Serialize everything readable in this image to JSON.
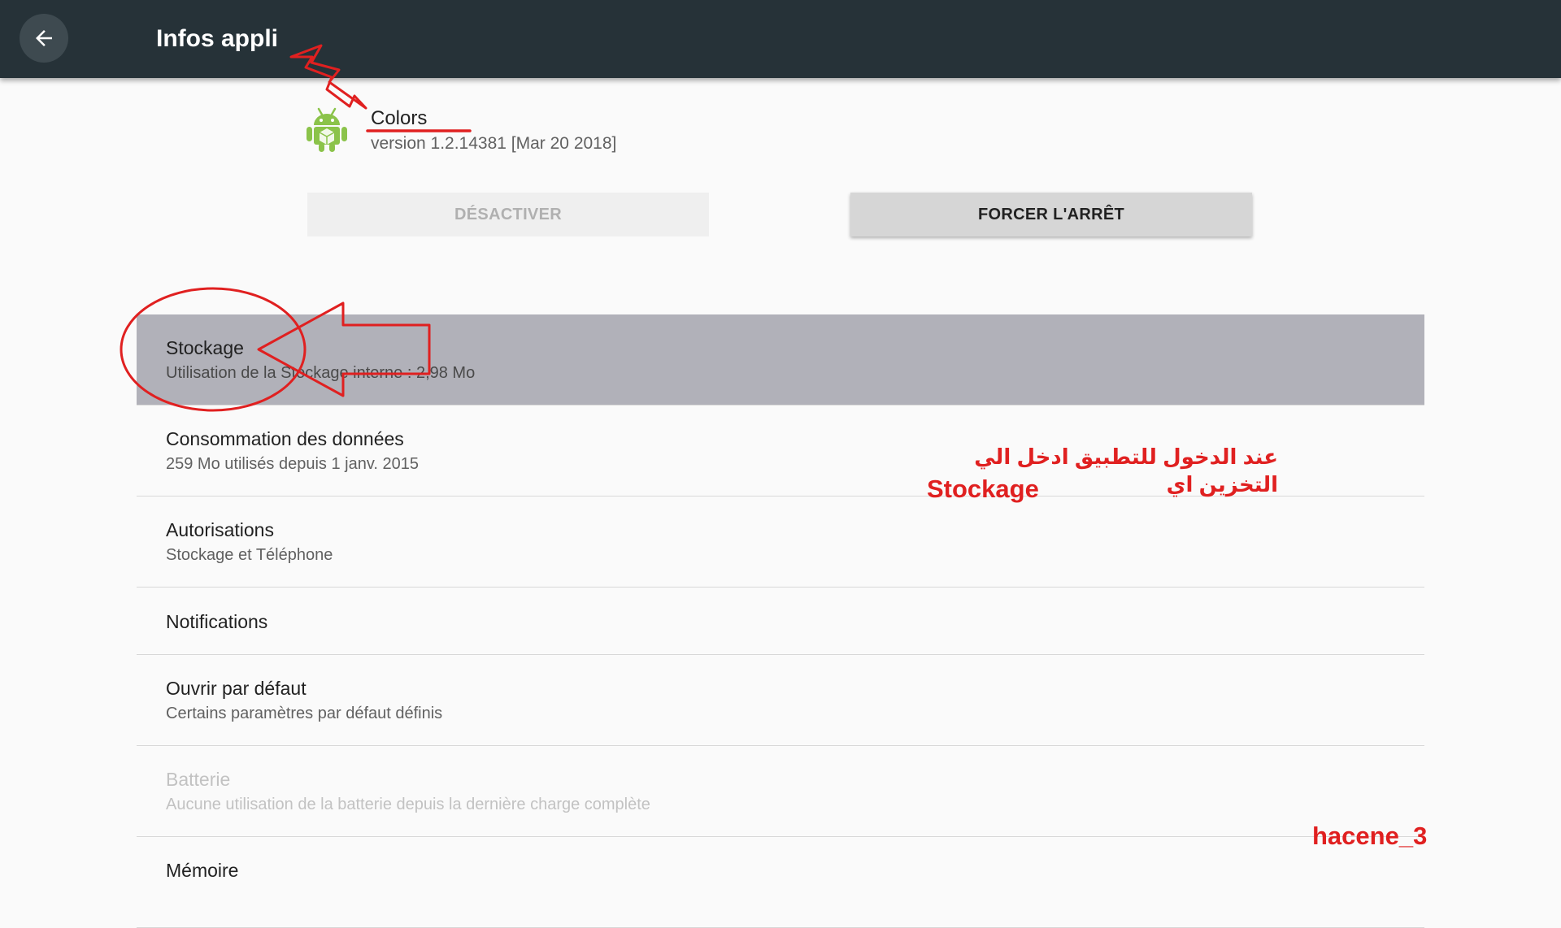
{
  "toolbar": {
    "title": "Infos appli",
    "back_icon": "arrow-back-icon"
  },
  "app": {
    "name": "Colors",
    "version": "version 1.2.14381 [Mar 20 2018]",
    "icon": "android-robot-icon"
  },
  "buttons": {
    "disable_label": "DÉSACTIVER",
    "force_stop_label": "FORCER L'ARRÊT"
  },
  "settings": {
    "storage": {
      "title": "Stockage",
      "summary": "Utilisation de la Stockage interne : 2,98 Mo"
    },
    "data_usage": {
      "title": "Consommation des données",
      "summary": "259 Mo utilisés depuis 1 janv. 2015"
    },
    "permissions": {
      "title": "Autorisations",
      "summary": "Stockage et Téléphone"
    },
    "notifications": {
      "title": "Notifications"
    },
    "open_by_default": {
      "title": "Ouvrir par défaut",
      "summary": "Certains paramètres par défaut définis"
    },
    "battery": {
      "title": "Batterie",
      "summary": "Aucune utilisation de la batterie depuis la dernière charge complète"
    },
    "memory": {
      "title": "Mémoire"
    }
  },
  "annotations": {
    "arabic_instruction": "عند الدخول للتطبيق ادخل الي التخزين اي",
    "stockage_label": "Stockage",
    "watermark": "hacene_3"
  },
  "colors": {
    "toolbar_bg": "#263238",
    "selected_row": "#b1b1b9",
    "annotation_red": "#e02020",
    "android_green": "#8bc34a"
  }
}
